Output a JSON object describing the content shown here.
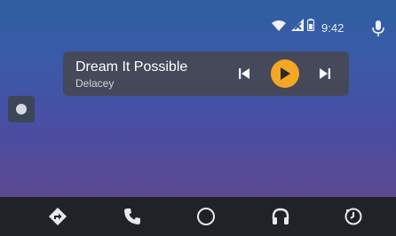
{
  "status": {
    "time": "9:42",
    "icons": [
      "wifi-icon",
      "no-signal-icon",
      "battery-icon",
      "mic-icon"
    ]
  },
  "media": {
    "title": "Dream It Possible",
    "artist": "Delacey",
    "controls": [
      "previous-track-icon",
      "play-icon",
      "next-track-icon"
    ],
    "accent": "#f5a623"
  },
  "nav": {
    "items": [
      "navigation-icon",
      "phone-icon",
      "home-icon",
      "headphones-icon",
      "recent-icon"
    ]
  },
  "colors": {
    "nav_background": "#1f2226",
    "card_background": "#464852"
  }
}
